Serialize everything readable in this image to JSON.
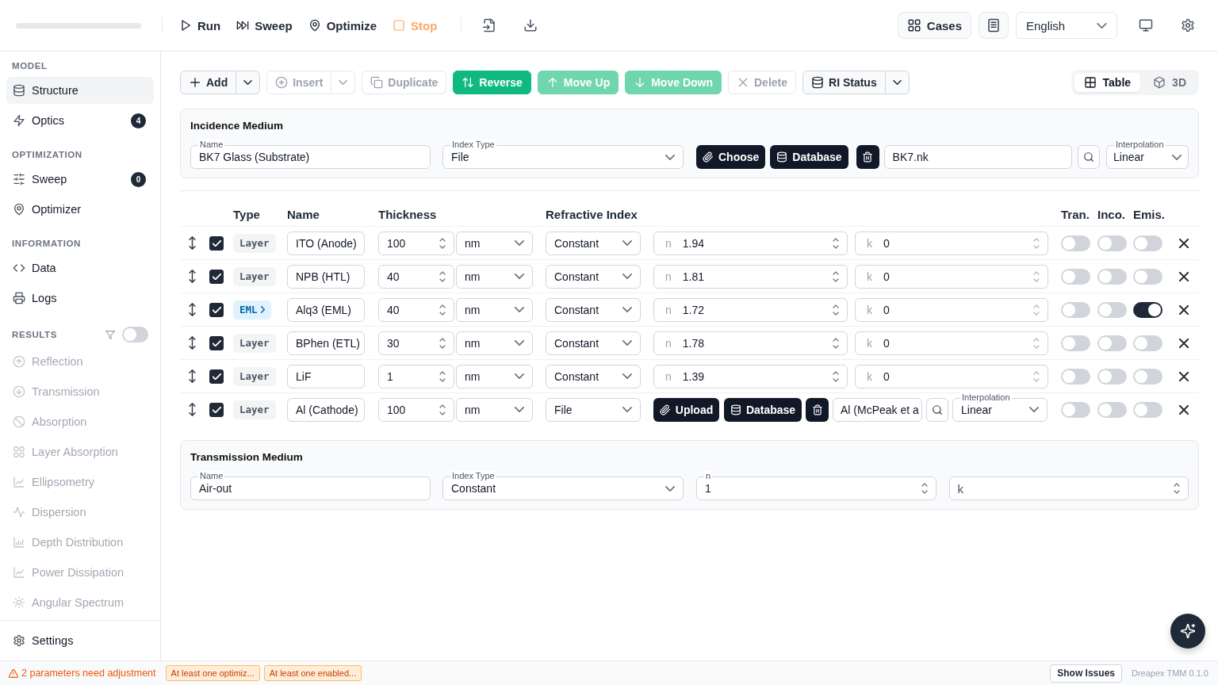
{
  "top_bar": {
    "actions": [
      {
        "label": "Run",
        "kind": "run",
        "disabled": false
      },
      {
        "label": "Sweep",
        "kind": "sweep",
        "disabled": false
      },
      {
        "label": "Optimize",
        "kind": "optimize",
        "disabled": false
      },
      {
        "label": "Stop",
        "kind": "stop",
        "disabled": true
      }
    ],
    "cases_button": "Cases",
    "language": "English"
  },
  "sidebar": {
    "sections": [
      {
        "title": "MODEL",
        "items": [
          {
            "label": "Structure",
            "selected": true,
            "disabled": false
          },
          {
            "label": "Optics",
            "badge": "4",
            "selected": false,
            "disabled": false
          }
        ]
      },
      {
        "title": "OPTIMIZATION",
        "items": [
          {
            "label": "Sweep",
            "badge": "0",
            "selected": false,
            "disabled": false
          },
          {
            "label": "Optimizer",
            "selected": false,
            "disabled": false
          }
        ]
      },
      {
        "title": "INFORMATION",
        "items": [
          {
            "label": "Data",
            "selected": false,
            "disabled": false
          },
          {
            "label": "Logs",
            "selected": false,
            "disabled": false
          }
        ]
      },
      {
        "title": "RESULTS",
        "filter": {
          "on": false
        },
        "items": [
          {
            "label": "Reflection",
            "selected": false,
            "disabled": true
          },
          {
            "label": "Transmission",
            "selected": false,
            "disabled": true
          },
          {
            "label": "Absorption",
            "selected": false,
            "disabled": true
          },
          {
            "label": "Layer Absorption",
            "selected": false,
            "disabled": true
          },
          {
            "label": "Ellipsometry",
            "selected": false,
            "disabled": true
          },
          {
            "label": "Dispersion",
            "selected": false,
            "disabled": true
          },
          {
            "label": "Depth Distribution",
            "selected": false,
            "disabled": true
          },
          {
            "label": "Power Dissipation",
            "selected": false,
            "disabled": true
          },
          {
            "label": "Angular Spectrum",
            "selected": false,
            "disabled": true
          }
        ]
      }
    ],
    "settings": "Settings"
  },
  "toolbar": {
    "buttons": [
      {
        "label": "Add",
        "kind": "split",
        "disabled": false
      },
      {
        "label": "Insert",
        "kind": "split",
        "disabled": true
      },
      {
        "label": "Duplicate",
        "kind": "plain",
        "disabled": true
      },
      {
        "label": "Reverse",
        "kind": "primary",
        "disabled": false
      },
      {
        "label": "Move Up",
        "kind": "primary",
        "disabled": true
      },
      {
        "label": "Move Down",
        "kind": "primary",
        "disabled": true
      },
      {
        "label": "Delete",
        "kind": "plain",
        "disabled": true
      },
      {
        "label": "RI Status",
        "kind": "split",
        "disabled": false
      }
    ],
    "views": [
      {
        "label": "Table",
        "selected": true
      },
      {
        "label": "3D",
        "selected": false
      }
    ]
  },
  "incidence_medium": {
    "title": "Incidence Medium",
    "name": {
      "label": "Name",
      "value": "BK7 Glass (Substrate)"
    },
    "index_type": {
      "label": "Index Type",
      "value": "File",
      "kind": "file"
    },
    "choose_button": "Choose",
    "database_button": "Database",
    "file": "BK7.nk",
    "interpolation": {
      "label": "Interpolation",
      "value": "Linear"
    }
  },
  "layers": {
    "columns": [
      "Type",
      "Name",
      "Thickness",
      "Refractive Index",
      "Tran.",
      "Inco.",
      "Emis."
    ],
    "rows": [
      {
        "checked": true,
        "type": {
          "label": "Layer",
          "kind": "layer"
        },
        "name": "ITO (Anode)",
        "thickness": "100",
        "unit": "nm",
        "index_type": {
          "value": "Constant",
          "kind": "constant"
        },
        "n": {
          "label": "n",
          "value": "1.94"
        },
        "k": {
          "label": "k",
          "value": "0"
        },
        "toggles": [
          {
            "on": false
          },
          {
            "on": false
          },
          {
            "on": false
          }
        ]
      },
      {
        "checked": true,
        "type": {
          "label": "Layer",
          "kind": "layer"
        },
        "name": "NPB (HTL)",
        "thickness": "40",
        "unit": "nm",
        "index_type": {
          "value": "Constant",
          "kind": "constant"
        },
        "n": {
          "label": "n",
          "value": "1.81"
        },
        "k": {
          "label": "k",
          "value": "0"
        },
        "toggles": [
          {
            "on": false
          },
          {
            "on": false
          },
          {
            "on": false
          }
        ]
      },
      {
        "checked": true,
        "type": {
          "label": "EML",
          "kind": "emission"
        },
        "name": "Alq3 (EML)",
        "thickness": "40",
        "unit": "nm",
        "index_type": {
          "value": "Constant",
          "kind": "constant"
        },
        "n": {
          "label": "n",
          "value": "1.72"
        },
        "k": {
          "label": "k",
          "value": "0"
        },
        "toggles": [
          {
            "on": false
          },
          {
            "on": false
          },
          {
            "on": true
          }
        ]
      },
      {
        "checked": true,
        "type": {
          "label": "Layer",
          "kind": "layer"
        },
        "name": "BPhen (ETL)",
        "thickness": "30",
        "unit": "nm",
        "index_type": {
          "value": "Constant",
          "kind": "constant"
        },
        "n": {
          "label": "n",
          "value": "1.78"
        },
        "k": {
          "label": "k",
          "value": "0"
        },
        "toggles": [
          {
            "on": false
          },
          {
            "on": false
          },
          {
            "on": false
          }
        ]
      },
      {
        "checked": true,
        "type": {
          "label": "Layer",
          "kind": "layer"
        },
        "name": "LiF",
        "thickness": "1",
        "unit": "nm",
        "index_type": {
          "value": "Constant",
          "kind": "constant"
        },
        "n": {
          "label": "n",
          "value": "1.39"
        },
        "k": {
          "label": "k",
          "value": "0"
        },
        "toggles": [
          {
            "on": false
          },
          {
            "on": false
          },
          {
            "on": false
          }
        ]
      },
      {
        "checked": true,
        "type": {
          "label": "Layer",
          "kind": "layer"
        },
        "name": "Al (Cathode)",
        "thickness": "100",
        "unit": "nm",
        "index_type": {
          "value": "File",
          "kind": "file"
        },
        "upload_button": "Upload",
        "database_button": "Database",
        "file": "Al (McPeak et a",
        "interpolation": {
          "label": "Interpolation",
          "value": "Linear"
        },
        "toggles": [
          {
            "on": false
          },
          {
            "on": false
          },
          {
            "on": false
          }
        ]
      }
    ]
  },
  "transmission_medium": {
    "title": "Transmission Medium",
    "name": {
      "label": "Name",
      "value": "Air-out"
    },
    "index_type": {
      "label": "Index Type",
      "value": "Constant",
      "kind": "constant"
    },
    "n": {
      "label": "n",
      "value": "1"
    },
    "k": {
      "placeholder": "k"
    }
  },
  "status_bar": {
    "warning": "2 parameters need adjustment",
    "issues": [
      "At least one optimiz...",
      "At least one enabled..."
    ],
    "show_issues_button": "Show Issues",
    "version": "Dreapex TMM 0.1.0"
  }
}
